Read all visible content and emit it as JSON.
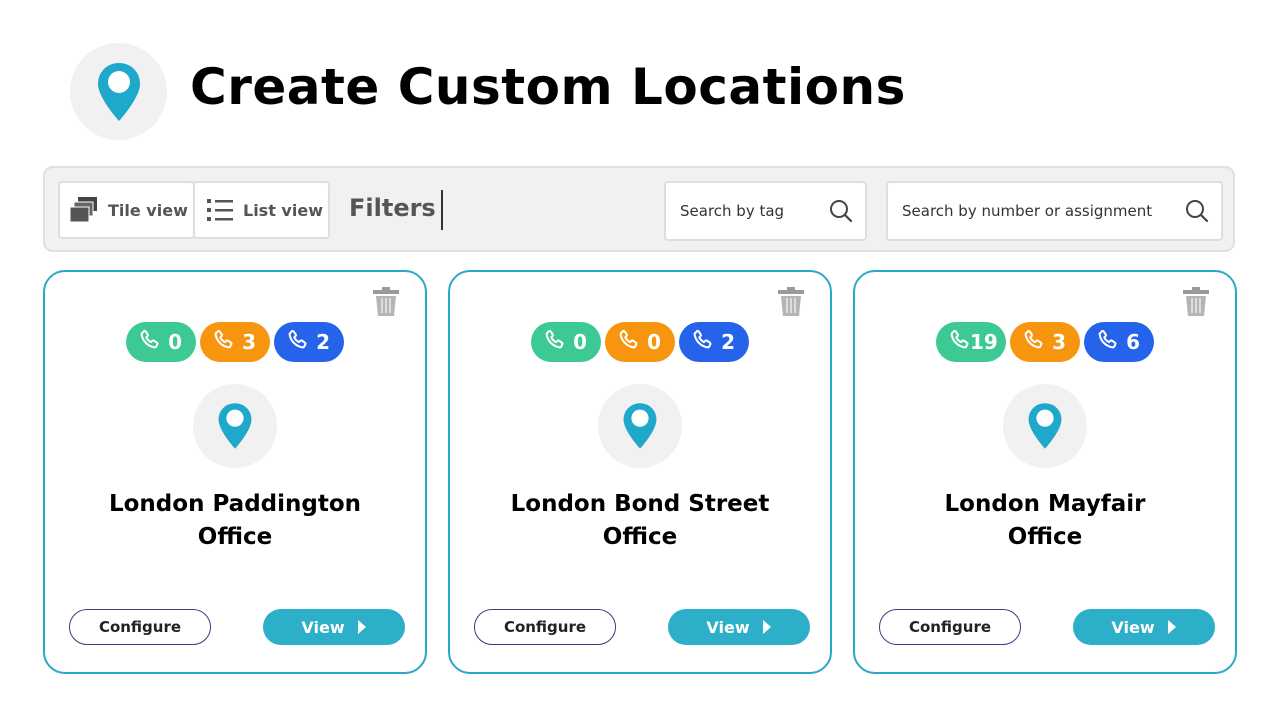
{
  "header": {
    "icon": "map-pin-icon",
    "title": "Create Custom Locations"
  },
  "toolbar": {
    "tile_view_label": "Tile view",
    "list_view_label": "List view",
    "filters_label": "Filters",
    "search_tag_placeholder": "Search by tag",
    "search_number_placeholder": "Search by number or assignment"
  },
  "colors": {
    "accent": "#2eafc9",
    "card_border": "#2aa9c5",
    "pin": "#1ea8cb",
    "badge_green": "#3cc993",
    "badge_orange": "#f7950f",
    "badge_blue": "#2563eb"
  },
  "cards": [
    {
      "title_line1": "London Paddington",
      "title_line2": "Office",
      "badges": [
        {
          "icon": "phone-icon",
          "value": "0"
        },
        {
          "icon": "phone-icon",
          "value": "3"
        },
        {
          "icon": "phone-icon",
          "value": "2"
        }
      ],
      "configure_label": "Configure",
      "view_label": "View"
    },
    {
      "title_line1": "London Bond Street",
      "title_line2": "Office",
      "badges": [
        {
          "icon": "phone-icon",
          "value": "0"
        },
        {
          "icon": "phone-icon",
          "value": "0"
        },
        {
          "icon": "phone-icon",
          "value": "2"
        }
      ],
      "configure_label": "Configure",
      "view_label": "View"
    },
    {
      "title_line1": "London Mayfair",
      "title_line2": "Office",
      "badges": [
        {
          "icon": "phone-icon",
          "value": "19"
        },
        {
          "icon": "phone-icon",
          "value": "3"
        },
        {
          "icon": "phone-icon",
          "value": "6"
        }
      ],
      "configure_label": "Configure",
      "view_label": "View"
    }
  ]
}
